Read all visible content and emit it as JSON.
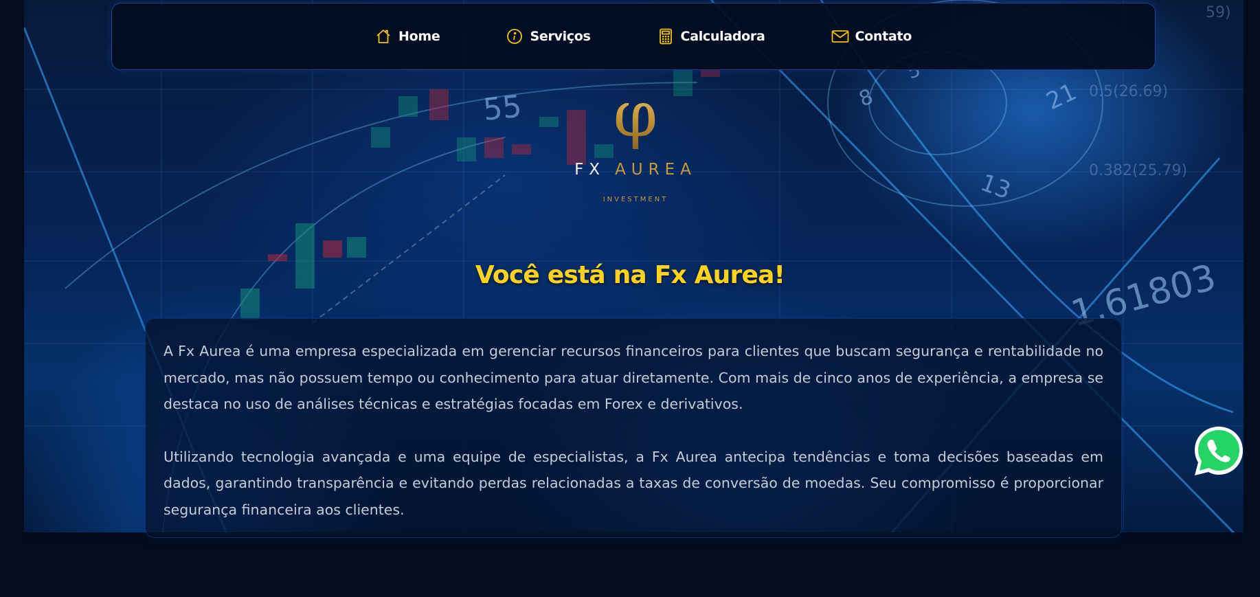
{
  "nav": {
    "items": [
      {
        "label": "Home",
        "icon": "home-icon"
      },
      {
        "label": "Serviços",
        "icon": "info-icon"
      },
      {
        "label": "Calculadora",
        "icon": "calculator-icon"
      },
      {
        "label": "Contato",
        "icon": "mail-icon"
      }
    ]
  },
  "logo": {
    "symbol": "φ",
    "brand_left": "FX",
    "brand_right": "AUREA",
    "tagline": "INVESTMENT"
  },
  "hero": {
    "headline": "Você está na Fx Aurea!"
  },
  "about": {
    "paragraphs": [
      "A Fx Aurea é uma empresa especializada em gerenciar recursos financeiros para clientes que buscam segurança e rentabilidade no mercado, mas não possuem tempo ou conhecimento para atuar diretamente. Com mais de cinco anos de experiência, a empresa se destaca no uso de análises técnicas e estratégias focadas em Forex e derivativos.",
      "Utilizando tecnologia avançada e uma equipe de especialistas, a Fx Aurea antecipa tendências e toma decisões baseadas em dados, garantindo transparência e evitando perdas relacionadas a taxas de conversão de moedas. Seu compromisso é proporcionar segurança financeira aos clientes."
    ]
  },
  "floating": {
    "whatsapp_icon": "whatsapp-icon"
  },
  "colors": {
    "accent_yellow": "#ffd21f",
    "gold": "#c79a3c",
    "nav_border": "#1d3f8c",
    "background": "#030c1e",
    "whatsapp_green": "#25d366"
  },
  "background_numbers": [
    "55",
    "8",
    "5",
    "21",
    "13",
    "0.5(26.69)",
    "0.382(25.79)",
    "1.61803",
    "59)"
  ]
}
